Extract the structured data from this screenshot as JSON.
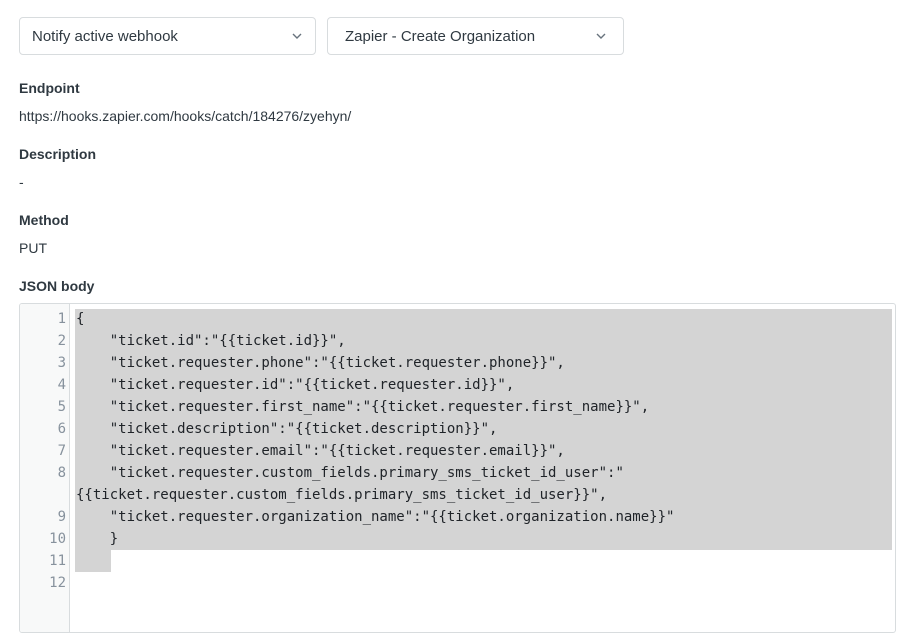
{
  "selects": {
    "action": {
      "value": "Notify active webhook",
      "icon": "chevron-down-icon"
    },
    "webhook": {
      "value": "Zapier - Create Organization",
      "icon": "chevron-down-icon"
    }
  },
  "details": {
    "endpoint_label": "Endpoint",
    "endpoint_value": "https://hooks.zapier.com/hooks/catch/184276/zyehyn/",
    "description_label": "Description",
    "description_value": "-",
    "method_label": "Method",
    "method_value": "PUT",
    "json_label": "JSON body"
  },
  "editor": {
    "line_numbers": [
      "1",
      "2",
      "3",
      "4",
      "5",
      "6",
      "7",
      "8",
      "9",
      "10",
      "11",
      "12"
    ],
    "lines": [
      "{",
      "    \"ticket.id\":\"{{ticket.id}}\",",
      "    \"ticket.requester.phone\":\"{{ticket.requester.phone}}\",",
      "    \"ticket.requester.id\":\"{{ticket.requester.id}}\",",
      "    \"ticket.requester.first_name\":\"{{ticket.requester.first_name}}\",",
      "    \"ticket.description\":\"{{ticket.description}}\",",
      "    \"ticket.requester.email\":\"{{ticket.requester.email}}\",",
      "    \"ticket.requester.custom_fields.primary_sms_ticket_id_user\":\"",
      "{{ticket.requester.custom_fields.primary_sms_ticket_id_user}}\",",
      "    \"ticket.requester.organization_name\":\"{{ticket.organization.name}}\"",
      "    }",
      "",
      ""
    ]
  }
}
